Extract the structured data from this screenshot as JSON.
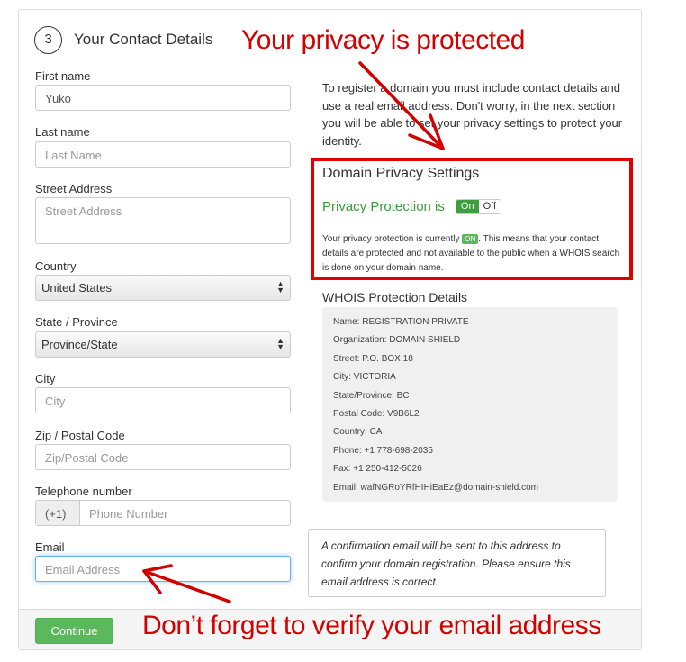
{
  "header": {
    "step": "3",
    "title": "Your Contact Details"
  },
  "form": {
    "first_name": {
      "label": "First name",
      "value": "Yuko"
    },
    "last_name": {
      "label": "Last name",
      "placeholder": "Last Name"
    },
    "street": {
      "label": "Street Address",
      "placeholder": "Street Address"
    },
    "country": {
      "label": "Country",
      "value": "United States"
    },
    "state": {
      "label": "State / Province",
      "value": "Province/State"
    },
    "city": {
      "label": "City",
      "placeholder": "City"
    },
    "zip": {
      "label": "Zip / Postal Code",
      "placeholder": "Zip/Postal Code"
    },
    "phone": {
      "label": "Telephone number",
      "prefix": "(+1)",
      "placeholder": "Phone Number"
    },
    "email": {
      "label": "Email",
      "placeholder": "Email Address"
    }
  },
  "intro": "To register a domain you must include contact details and use a real email address. Don't worry, in the next section you will be able to set your privacy settings to protect your identity.",
  "privacy": {
    "title": "Domain Privacy Settings",
    "label": "Privacy Protection is",
    "on": "On",
    "off": "Off",
    "status_pre": "Your privacy protection is currently",
    "badge": "ON",
    "status_post": ". This means that your contact details are protected and not available to the public when a WHOIS search is done on your domain name.",
    "enabled": true
  },
  "whois": {
    "title": "WHOIS Protection Details",
    "lines": [
      "Name: REGISTRATION PRIVATE",
      "Organization: DOMAIN SHIELD",
      "Street: P.O. BOX 18",
      "City: VICTORIA",
      "State/Province: BC",
      "Postal Code: V9B6L2",
      "Country: CA",
      "Phone: +1 778-698-2035",
      "Fax: +1 250-412-5026",
      "Email: wafNGRoYRfHIHiEaEz@domain-shield.com"
    ]
  },
  "tooltip": "A confirmation email will be sent to this address to confirm your domain registration. Please ensure this email address is correct.",
  "continue_label": "Continue",
  "annotations": {
    "top": "Your privacy is protected",
    "bottom": "Don’t forget to verify your email address",
    "color": "#d40000"
  }
}
